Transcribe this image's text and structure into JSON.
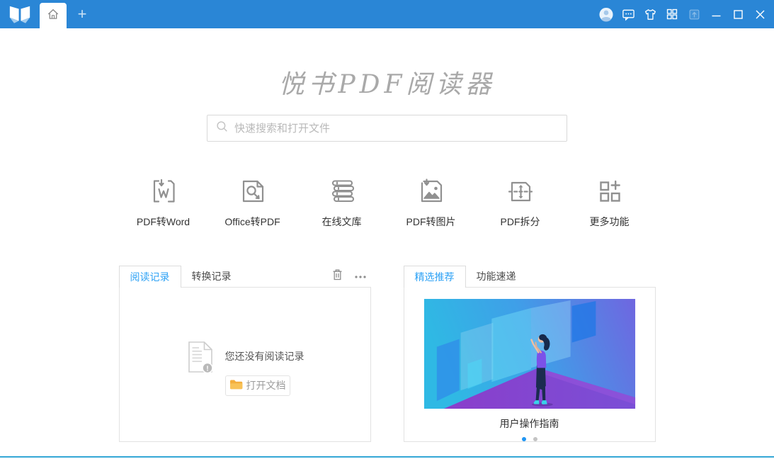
{
  "window": {
    "tab": "home",
    "new_tab_label": "+",
    "titlebar_icons": [
      "app-logo",
      "home",
      "new-tab",
      "user-avatar",
      "feedback",
      "theme-skin",
      "apps-grid",
      "upload",
      "minimize",
      "maximize",
      "close"
    ]
  },
  "hero": {
    "title": "悦书PDF阅读器",
    "search_placeholder": "快速搜索和打开文件",
    "search_icon": "magnifier"
  },
  "features": [
    {
      "label": "PDF转Word",
      "icon": "pdf-to-word-icon"
    },
    {
      "label": "Office转PDF",
      "icon": "office-to-pdf-icon"
    },
    {
      "label": "在线文库",
      "icon": "online-library-icon"
    },
    {
      "label": "PDF转图片",
      "icon": "pdf-to-image-icon"
    },
    {
      "label": "PDF拆分",
      "icon": "pdf-split-icon"
    },
    {
      "label": "更多功能",
      "icon": "more-features-icon"
    }
  ],
  "records_panel": {
    "tabs": [
      {
        "label": "阅读记录",
        "active": true
      },
      {
        "label": "转换记录",
        "active": false
      }
    ],
    "action_icons": [
      "trash",
      "ellipsis"
    ],
    "empty": {
      "message": "您还没有阅读记录",
      "button": "打开文档",
      "button_icon": "folder"
    }
  },
  "recommend_panel": {
    "tabs": [
      {
        "label": "精选推荐",
        "active": true
      },
      {
        "label": "功能速递",
        "active": false
      }
    ],
    "card": {
      "caption": "用户操作指南"
    },
    "pager": {
      "total": 2,
      "active_index": 0
    }
  },
  "colors": {
    "titlebar_blue": "#2a86d6",
    "active_tab_blue": "#2ea2f5",
    "bottom_line_cyan": "#35a7d6",
    "folder_orange": "#f3ae3d",
    "pager_active_blue": "#2196f3",
    "icon_gray": "#909090"
  }
}
